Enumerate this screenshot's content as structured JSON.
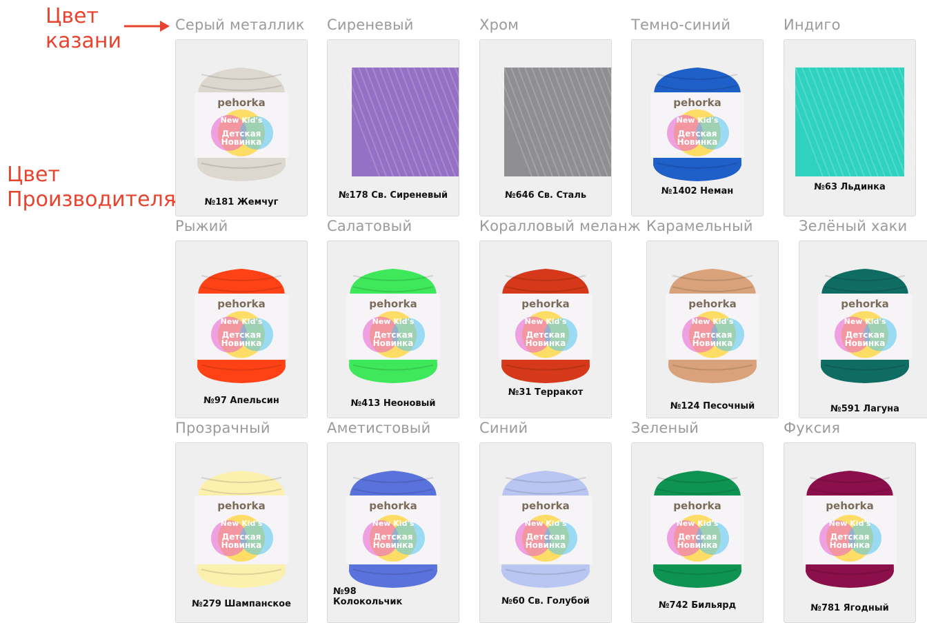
{
  "notes": {
    "kazan": [
      "Цвет",
      "казани"
    ],
    "maker": [
      "Цвет",
      "Производителя"
    ]
  },
  "swatches": [
    {
      "name": "Серый металлик",
      "code": "№181 Жемчуг",
      "color": "#dcd7cf",
      "kind": "ball"
    },
    {
      "name": "Сиреневый",
      "code": "№178  Св. Сиреневый",
      "color": "#9670c4",
      "kind": "square"
    },
    {
      "name": "Хром",
      "code": "№646  Св. Сталь",
      "color": "#8f8f93",
      "kind": "square"
    },
    {
      "name": "Темно-синий",
      "code": "№1402  Неман",
      "color": "#1f5fc8",
      "kind": "ball"
    },
    {
      "name": "Индиго",
      "code": "№63  Льдинка",
      "color": "#2fd2bf",
      "kind": "square"
    },
    {
      "name": "Рыжий",
      "code": "№97  Апельсин",
      "color": "#ff4216",
      "kind": "ball"
    },
    {
      "name": "Салатовый",
      "code": "№413  Неоновый",
      "color": "#3ee85a",
      "kind": "ball"
    },
    {
      "name": "Коралловый меланж",
      "code": "№31 Терракот",
      "color": "#d5381a",
      "kind": "ball"
    },
    {
      "name": "Карамельный",
      "code": "№124   Песочный",
      "color": "#d9a27a",
      "kind": "ball"
    },
    {
      "name": "Зелёный хаки",
      "code": "№591  Лагуна",
      "color": "#0e6c62",
      "kind": "ball"
    },
    {
      "name": "Прозрачный",
      "code": "№279 Шампанское",
      "color": "#fbf0ae",
      "kind": "ball"
    },
    {
      "name": "Аметистовый",
      "code": "№98\nКолокольчик",
      "color": "#5a72dc",
      "kind": "ball",
      "left": true
    },
    {
      "name": "Синий",
      "code": "№60  Св. Голубой",
      "color": "#b9c6f1",
      "kind": "ball"
    },
    {
      "name": "Зеленый",
      "code": "№742  Бильярд",
      "color": "#0e9352",
      "kind": "ball"
    },
    {
      "name": "Фуксия",
      "code": "№781  Ягодный",
      "color": "#8a0f4a",
      "kind": "ball"
    }
  ],
  "label": {
    "brand": "pehorka",
    "line1": "New Kid's",
    "line2": "Детская",
    "line3": "Новинка"
  }
}
